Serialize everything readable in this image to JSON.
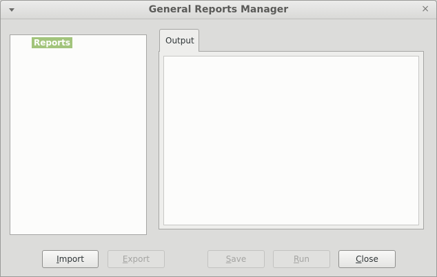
{
  "window": {
    "title": "General Reports Manager",
    "menu_icon": "chevron-down-icon",
    "close_icon": "close-icon",
    "close_glyph": "×"
  },
  "tree": {
    "items": [
      {
        "label": "Reports",
        "selected": true
      }
    ],
    "selection_color": "#a2c47c"
  },
  "tabs": [
    {
      "label": "Output",
      "active": true
    }
  ],
  "buttons": {
    "import": {
      "mnemonic": "I",
      "rest": "mport",
      "enabled": true
    },
    "export": {
      "mnemonic": "E",
      "rest": "xport",
      "enabled": false
    },
    "save": {
      "mnemonic": "S",
      "rest": "ave",
      "enabled": false
    },
    "run": {
      "mnemonic": "R",
      "rest": "un",
      "enabled": false
    },
    "close": {
      "mnemonic": "C",
      "rest": "lose",
      "enabled": true
    }
  }
}
